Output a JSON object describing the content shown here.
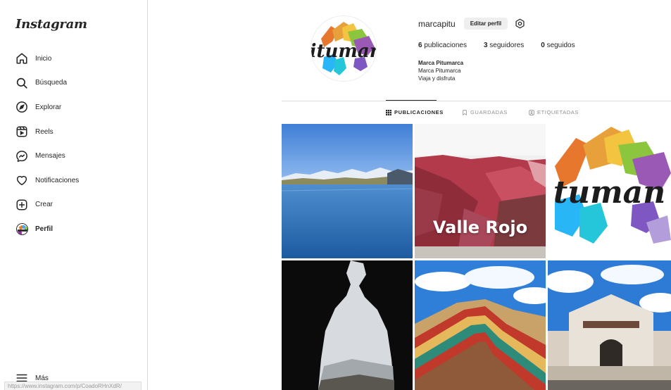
{
  "sidebar": {
    "logo": "Instagram",
    "items": [
      {
        "label": "Inicio",
        "icon": "home-icon"
      },
      {
        "label": "Búsqueda",
        "icon": "search-icon"
      },
      {
        "label": "Explorar",
        "icon": "compass-icon"
      },
      {
        "label": "Reels",
        "icon": "reels-icon"
      },
      {
        "label": "Mensajes",
        "icon": "messenger-icon"
      },
      {
        "label": "Notificaciones",
        "icon": "heart-icon"
      },
      {
        "label": "Crear",
        "icon": "plus-square-icon"
      },
      {
        "label": "Perfil",
        "icon": "avatar",
        "active": true
      }
    ],
    "more_label": "Más",
    "status_url": "https://www.instagram.com/p/CoadoRHnXdR/"
  },
  "profile": {
    "username": "marcapitu",
    "edit_label": "Editar perfil",
    "stats": {
      "posts_count": "6",
      "posts_label": "publicaciones",
      "followers_count": "3",
      "followers_label": "seguidores",
      "following_count": "0",
      "following_label": "seguidos"
    },
    "bio_name": "Marca Pitumarca",
    "bio_lines": [
      "Marca Pitumarca",
      "Viaja y disfruta"
    ],
    "logo_text": "itumar"
  },
  "tabs": [
    {
      "label": "PUBLICACIONES",
      "icon": "grid-icon",
      "active": true
    },
    {
      "label": "GUARDADAS",
      "icon": "bookmark-icon"
    },
    {
      "label": "ETIQUETADAS",
      "icon": "tagged-icon"
    }
  ],
  "posts": [
    {
      "name": "post-lake"
    },
    {
      "name": "post-valle-rojo",
      "overlay": "Valle Rojo"
    },
    {
      "name": "post-pitumarca-logo",
      "overlay": "tuman"
    },
    {
      "name": "post-cave"
    },
    {
      "name": "post-rainbow-mountain"
    },
    {
      "name": "post-church"
    }
  ],
  "colors": {
    "text": "#262626",
    "muted": "#8e8e8e",
    "border": "#dbdbdb",
    "button_bg": "#efefef"
  }
}
